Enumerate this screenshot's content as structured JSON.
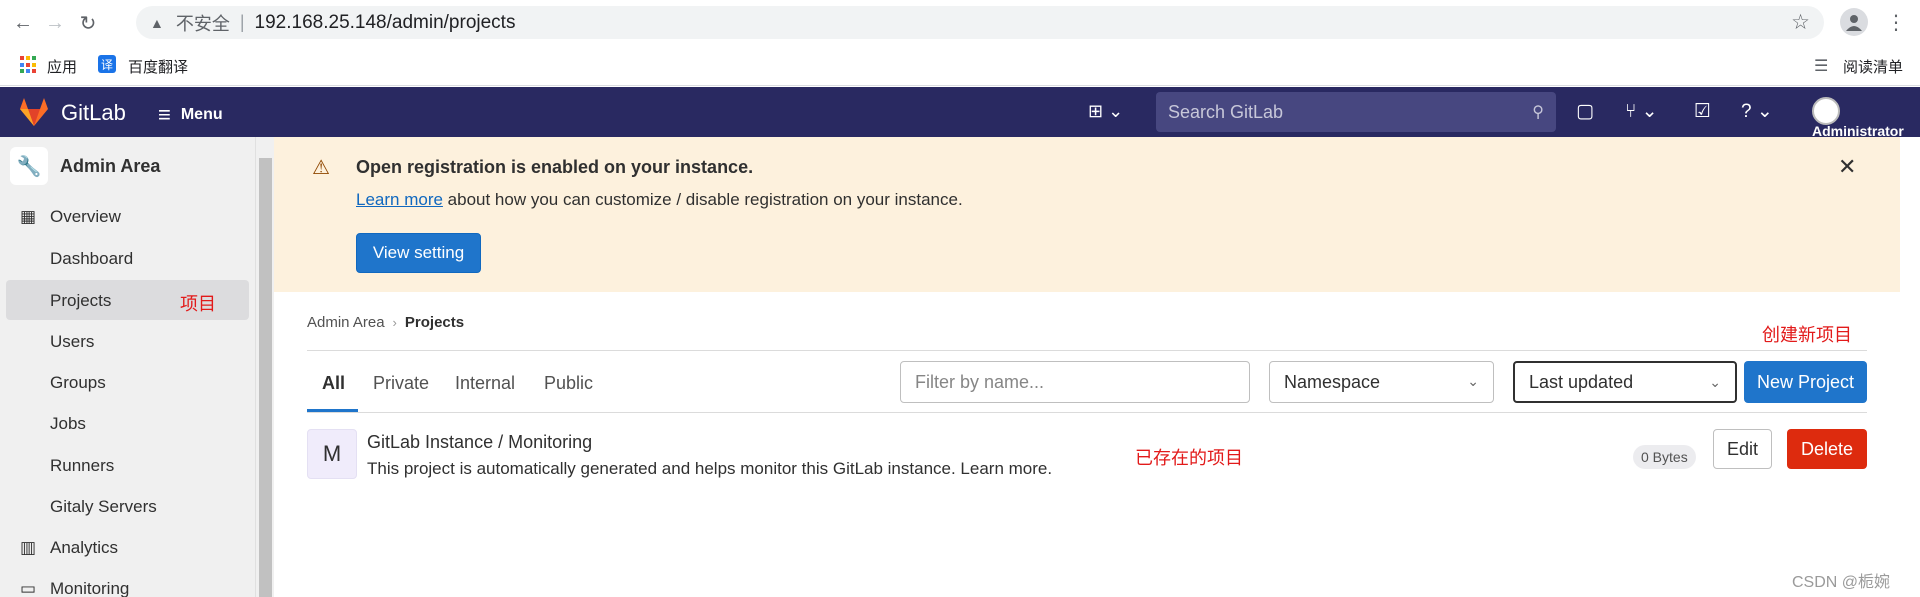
{
  "browser": {
    "insecure_label": "不安全",
    "url": "192.168.25.148/admin/projects",
    "bookmarks": {
      "apps": "应用",
      "translate_badge": "译",
      "translate": "百度翻译",
      "reading_list": "阅读清单"
    }
  },
  "header": {
    "brand": "GitLab",
    "menu_label": "Menu",
    "search_placeholder": "Search GitLab",
    "user_label": "Administrator"
  },
  "sidebar": {
    "title": "Admin Area",
    "overview": "Overview",
    "items": [
      {
        "label": "Dashboard"
      },
      {
        "label": "Projects"
      },
      {
        "label": "Users"
      },
      {
        "label": "Groups"
      },
      {
        "label": "Jobs"
      },
      {
        "label": "Runners"
      },
      {
        "label": "Gitaly Servers"
      }
    ],
    "analytics": "Analytics",
    "monitoring": "Monitoring"
  },
  "alert": {
    "title": "Open registration is enabled on your instance.",
    "link": "Learn more",
    "body_rest": " about how you can customize / disable registration on your instance.",
    "button": "View setting"
  },
  "breadcrumb": {
    "parent": "Admin Area",
    "current": "Projects"
  },
  "tabs": [
    "All",
    "Private",
    "Internal",
    "Public"
  ],
  "filters": {
    "filter_placeholder": "Filter by name...",
    "namespace": "Namespace",
    "sort": "Last updated",
    "new_project": "New Project"
  },
  "project": {
    "avatar_letter": "M",
    "name": "GitLab Instance / Monitoring",
    "description": "This project is automatically generated and helps monitor this GitLab instance. Learn more.",
    "size": "0 Bytes",
    "edit": "Edit",
    "delete": "Delete"
  },
  "annotations": {
    "projects": "项目",
    "create_new": "创建新项目",
    "existing": "已存在的项目"
  },
  "watermark": "CSDN @栀婉",
  "colors": {
    "header_bg": "#292961",
    "primary": "#1f75cb",
    "danger": "#dd2b0e",
    "alert_bg": "#fdf1dd",
    "annotation": "#e21a1a"
  }
}
